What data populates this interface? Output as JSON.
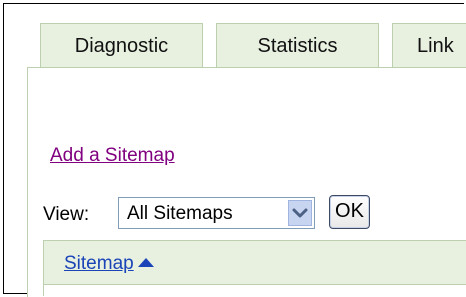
{
  "tabs": [
    {
      "label": "Diagnostic"
    },
    {
      "label": "Statistics"
    },
    {
      "label": "Link"
    }
  ],
  "add_sitemap_link": "Add a Sitemap",
  "view": {
    "label": "View:",
    "selected": "All Sitemaps",
    "ok_label": "OK"
  },
  "table": {
    "columns": [
      {
        "label": "Sitemap",
        "sort": "ascending"
      }
    ]
  },
  "colors": {
    "tab_background": "#e8f0e0",
    "link_visited": "#800080",
    "link": "#1a44b8"
  },
  "icons": {
    "select_arrow": "chevron-down-icon",
    "sort": "sort-ascending-icon"
  }
}
